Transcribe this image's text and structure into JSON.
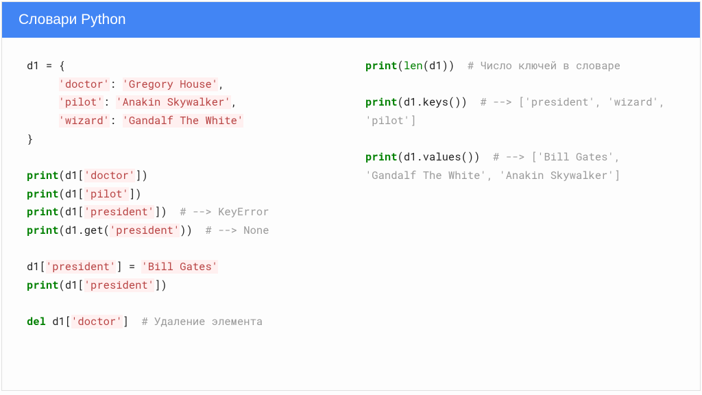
{
  "header": {
    "title": "Словари Python"
  },
  "code": {
    "l1": "d1 = {",
    "l2a": "     ",
    "l2s": "'doctor'",
    "l2b": ": ",
    "l2c": "'Gregory House'",
    "l2d": ",",
    "l3a": "     ",
    "l3s": "'pilot'",
    "l3b": ": ",
    "l3c": "'Anakin Skywalker'",
    "l3d": ",",
    "l4a": "     ",
    "l4s": "'wizard'",
    "l4b": ": ",
    "l4c": "'Gandalf The White'",
    "l5": "}",
    "p1a": "print",
    "p1b": "(d1[",
    "p1s": "'doctor'",
    "p1c": "])",
    "p2a": "print",
    "p2b": "(d1[",
    "p2s": "'pilot'",
    "p2c": "])",
    "p3a": "print",
    "p3b": "(d1[",
    "p3s": "'president'",
    "p3c": "])  ",
    "p3d": "# --> KeyError",
    "p4a": "print",
    "p4b": "(d1.get(",
    "p4s": "'president'",
    "p4c": "))  ",
    "p4d": "# --> None",
    "a1a": "d1[",
    "a1s": "'president'",
    "a1b": "] = ",
    "a1c": "'Bill Gates'",
    "a2a": "print",
    "a2b": "(d1[",
    "a2s": "'president'",
    "a2c": "])",
    "d1a": "del",
    "d1b": " d1[",
    "d1s": "'doctor'",
    "d1c": "]  ",
    "d1d": "# Удаление элемента",
    "r1a": "print",
    "r1b": "(",
    "r1c": "len",
    "r1d": "(d1))  ",
    "r1e": "# Число ключей в словаре",
    "r2a": "print",
    "r2b": "(d1.keys())  ",
    "r2c": "# --> ['president', 'wizard', 'pilot']",
    "r3a": "print",
    "r3b": "(d1.values())  ",
    "r3c": "# --> ['Bill Gates', 'Gandalf The White', 'Anakin Skywalker']"
  }
}
